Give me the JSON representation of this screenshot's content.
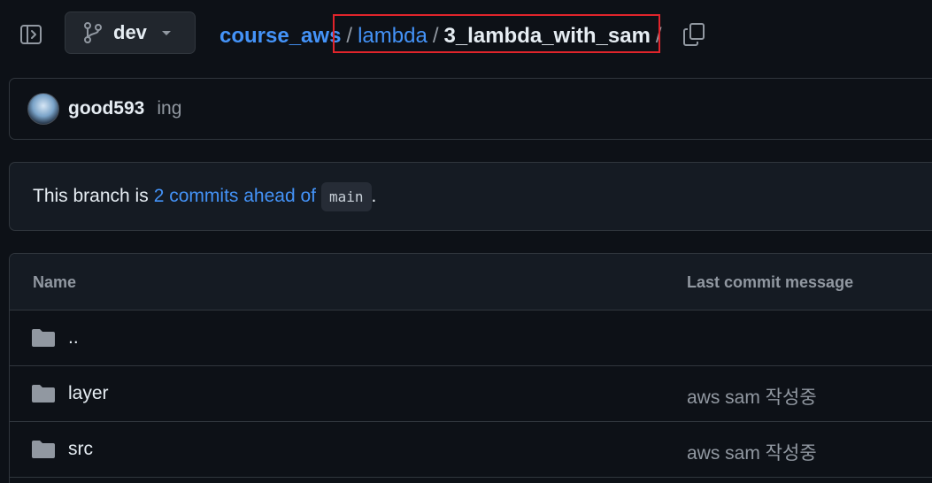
{
  "header": {
    "branch": "dev",
    "breadcrumb": {
      "repo": "course_aws",
      "folder": "lambda",
      "current": "3_lambda_with_sam",
      "separator": "/"
    }
  },
  "commit": {
    "author": "good593",
    "message": "ing"
  },
  "branch_info": {
    "prefix": "This branch is",
    "ahead_link": "2 commits ahead of",
    "base_branch": "main",
    "suffix": "."
  },
  "table": {
    "headers": {
      "name": "Name",
      "message": "Last commit message"
    },
    "rows": [
      {
        "name": "..",
        "message": ""
      },
      {
        "name": "layer",
        "message": "aws sam 작성중"
      },
      {
        "name": "src",
        "message": "aws sam 작성중"
      }
    ]
  },
  "colors": {
    "background": "#0d1117",
    "link": "#4493f8",
    "highlight": "#e0242b"
  }
}
